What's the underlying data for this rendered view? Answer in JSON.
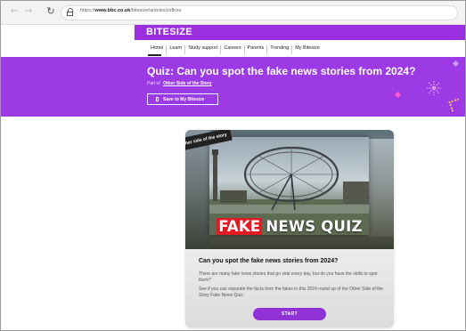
{
  "browser": {
    "url_prefix": "https://",
    "url_domain": "www.bbc.co.uk",
    "url_path": "/bitesize/articles/zsflcxs"
  },
  "header": {
    "brand": "BITESIZE",
    "nav": [
      "Home",
      "Learn",
      "Study support",
      "Careers",
      "Parents",
      "Trending",
      "My Bitesize"
    ]
  },
  "banner": {
    "title": "Quiz: Can you spot the fake news stories from 2024?",
    "part_of_label": "Part of",
    "part_of_link": "Other Side of the Story",
    "save_label": "Save to My Bitesize"
  },
  "card": {
    "image_tag": "other side of the story",
    "overlay_fake": "FAKE",
    "overlay_rest": "NEWS QUIZ",
    "title": "Can you spot the fake news stories from 2024?",
    "desc1": "There are many fake news stories that go viral every day, but do you have the skills to spot them?",
    "desc2": "See if you can separate the facts from the fakes in this 2024 round up of the Other Side of the Story Fake News Quiz.",
    "start_label": "START"
  },
  "colors": {
    "brand_purple": "#9b2fe0",
    "banner_purple": "#9c3be6",
    "fake_red": "#e21b22",
    "start_button": "#8f33d6"
  }
}
